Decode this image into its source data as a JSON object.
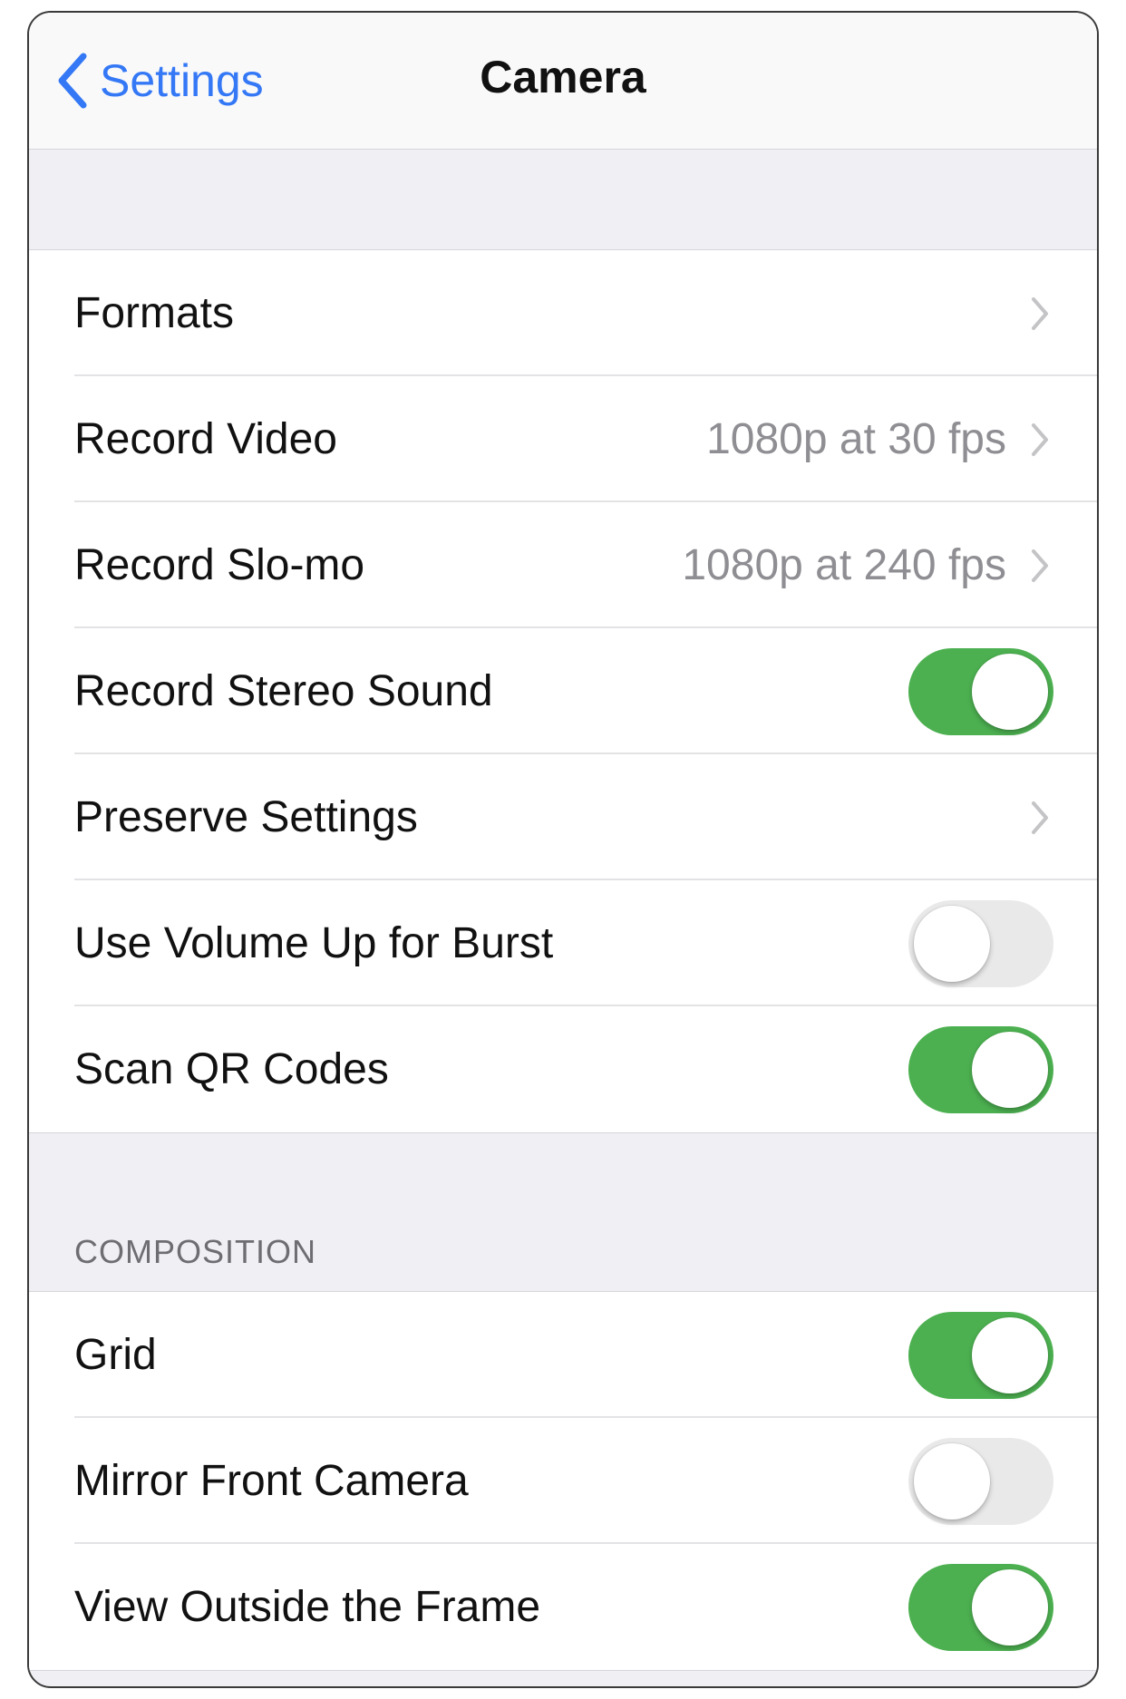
{
  "navbar": {
    "back_label": "Settings",
    "title": "Camera",
    "back_icon": "chevron-left-icon"
  },
  "colors": {
    "accent": "#3478f6",
    "toggle_on": "#4cb050",
    "toggle_off": "#e9e9ea"
  },
  "group1": {
    "rows": [
      {
        "label": "Formats",
        "detail": "",
        "control": "chevron"
      },
      {
        "label": "Record Video",
        "detail": "1080p at 30 fps",
        "control": "chevron"
      },
      {
        "label": "Record Slo-mo",
        "detail": "1080p at 240 fps",
        "control": "chevron"
      },
      {
        "label": "Record Stereo Sound",
        "control": "toggle",
        "on": true
      },
      {
        "label": "Preserve Settings",
        "detail": "",
        "control": "chevron"
      },
      {
        "label": "Use Volume Up for Burst",
        "control": "toggle",
        "on": false
      },
      {
        "label": "Scan QR Codes",
        "control": "toggle",
        "on": true
      }
    ]
  },
  "composition": {
    "header": "COMPOSITION",
    "rows": [
      {
        "label": "Grid",
        "control": "toggle",
        "on": true
      },
      {
        "label": "Mirror Front Camera",
        "control": "toggle",
        "on": false
      },
      {
        "label": "View Outside the Frame",
        "control": "toggle",
        "on": true
      }
    ]
  }
}
